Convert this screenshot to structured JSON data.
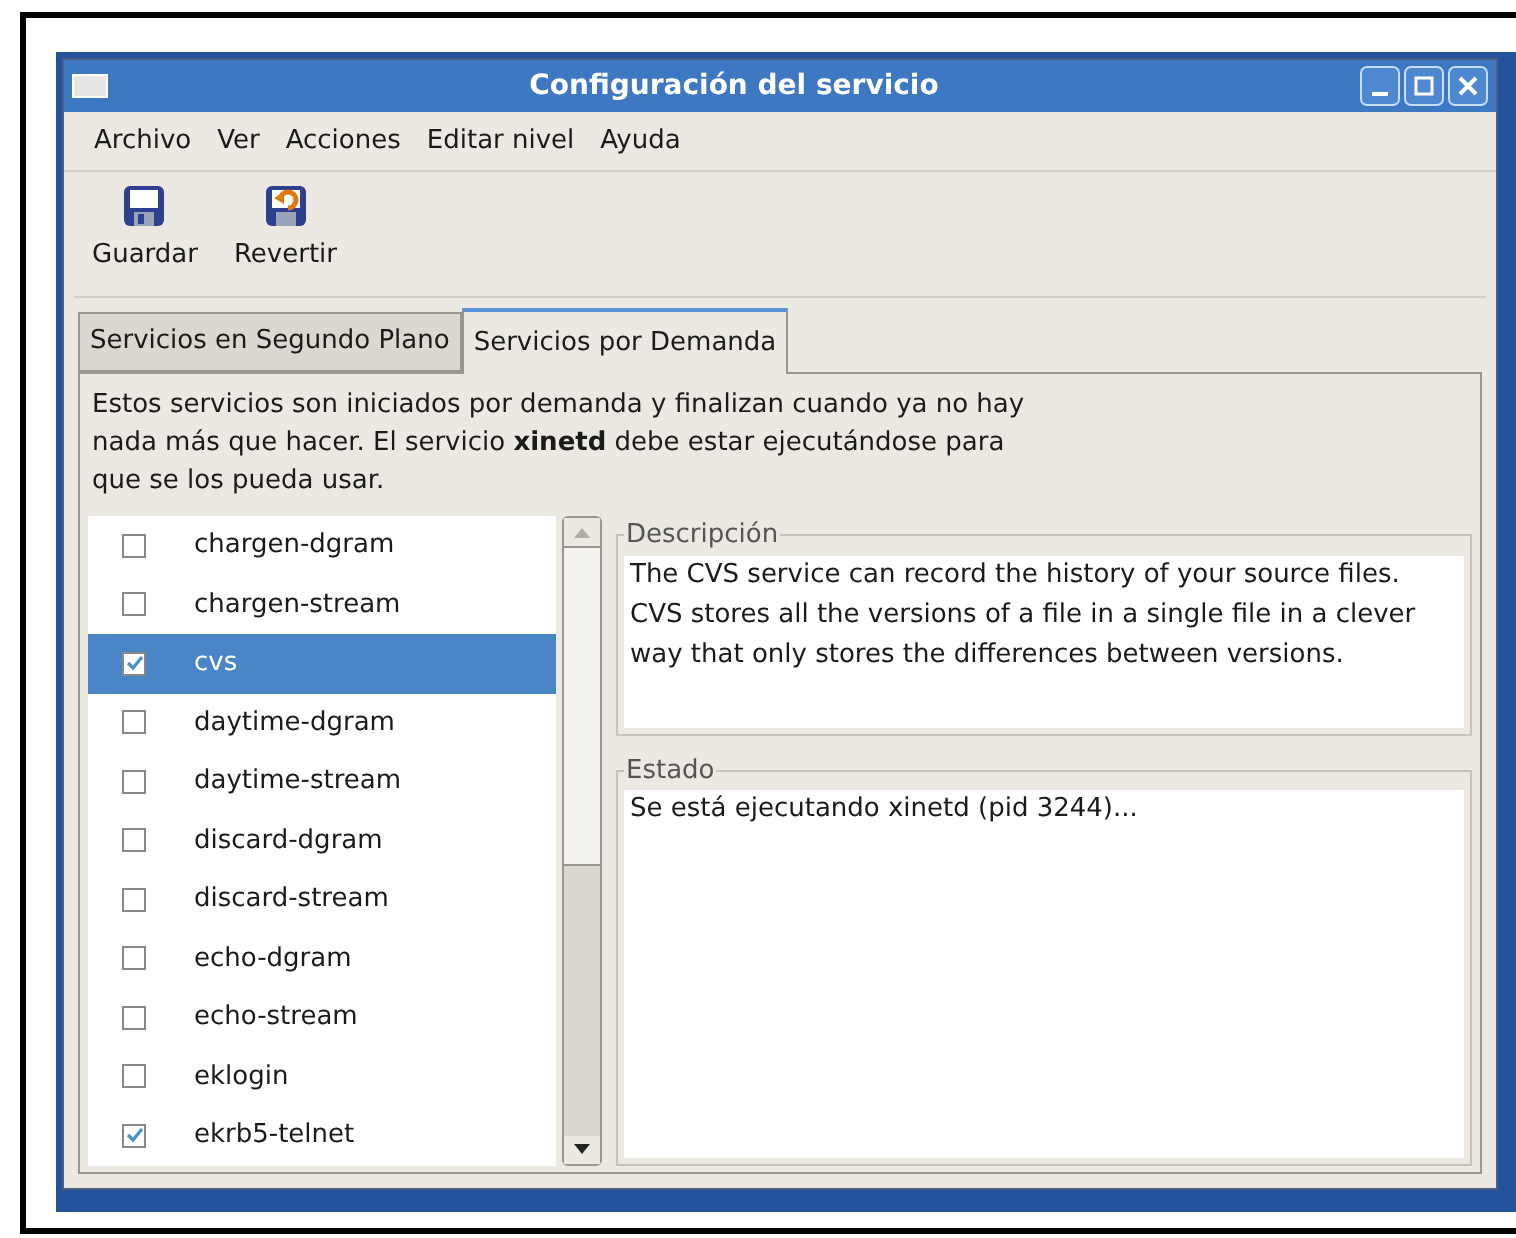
{
  "window": {
    "title": "Configuración del servicio"
  },
  "menu": [
    "Archivo",
    "Ver",
    "Acciones",
    "Editar nivel",
    "Ayuda"
  ],
  "toolbar": [
    {
      "kind": "save",
      "label": "Guardar"
    },
    {
      "kind": "revert",
      "label": "Revertir"
    }
  ],
  "tabs": [
    {
      "label": "Servicios en Segundo Plano",
      "selected": false
    },
    {
      "label": "Servicios por Demanda",
      "selected": true
    }
  ],
  "intro": "Estos servicios son iniciados por demanda y finalizan cuando ya no hay nada más que hacer. El servicio **xinetd** debe estar ejecutándose para que se los pueda usar.",
  "services": [
    {
      "name": "chargen-dgram",
      "checked": false,
      "selected": false
    },
    {
      "name": "chargen-stream",
      "checked": false,
      "selected": false
    },
    {
      "name": "cvs",
      "checked": true,
      "selected": true
    },
    {
      "name": "daytime-dgram",
      "checked": false,
      "selected": false
    },
    {
      "name": "daytime-stream",
      "checked": false,
      "selected": false
    },
    {
      "name": "discard-dgram",
      "checked": false,
      "selected": false
    },
    {
      "name": "discard-stream",
      "checked": false,
      "selected": false
    },
    {
      "name": "echo-dgram",
      "checked": false,
      "selected": false
    },
    {
      "name": "echo-stream",
      "checked": false,
      "selected": false
    },
    {
      "name": "eklogin",
      "checked": false,
      "selected": false
    },
    {
      "name": "ekrb5-telnet",
      "checked": true,
      "selected": false
    }
  ],
  "description": {
    "label": "Descripción",
    "text": "The CVS service can record the history of your source files. CVS stores all the versions of a file in a single file in a clever way that only stores the differences between versions."
  },
  "status": {
    "label": "Estado",
    "text": "Se está ejecutando xinetd (pid 3244)..."
  }
}
